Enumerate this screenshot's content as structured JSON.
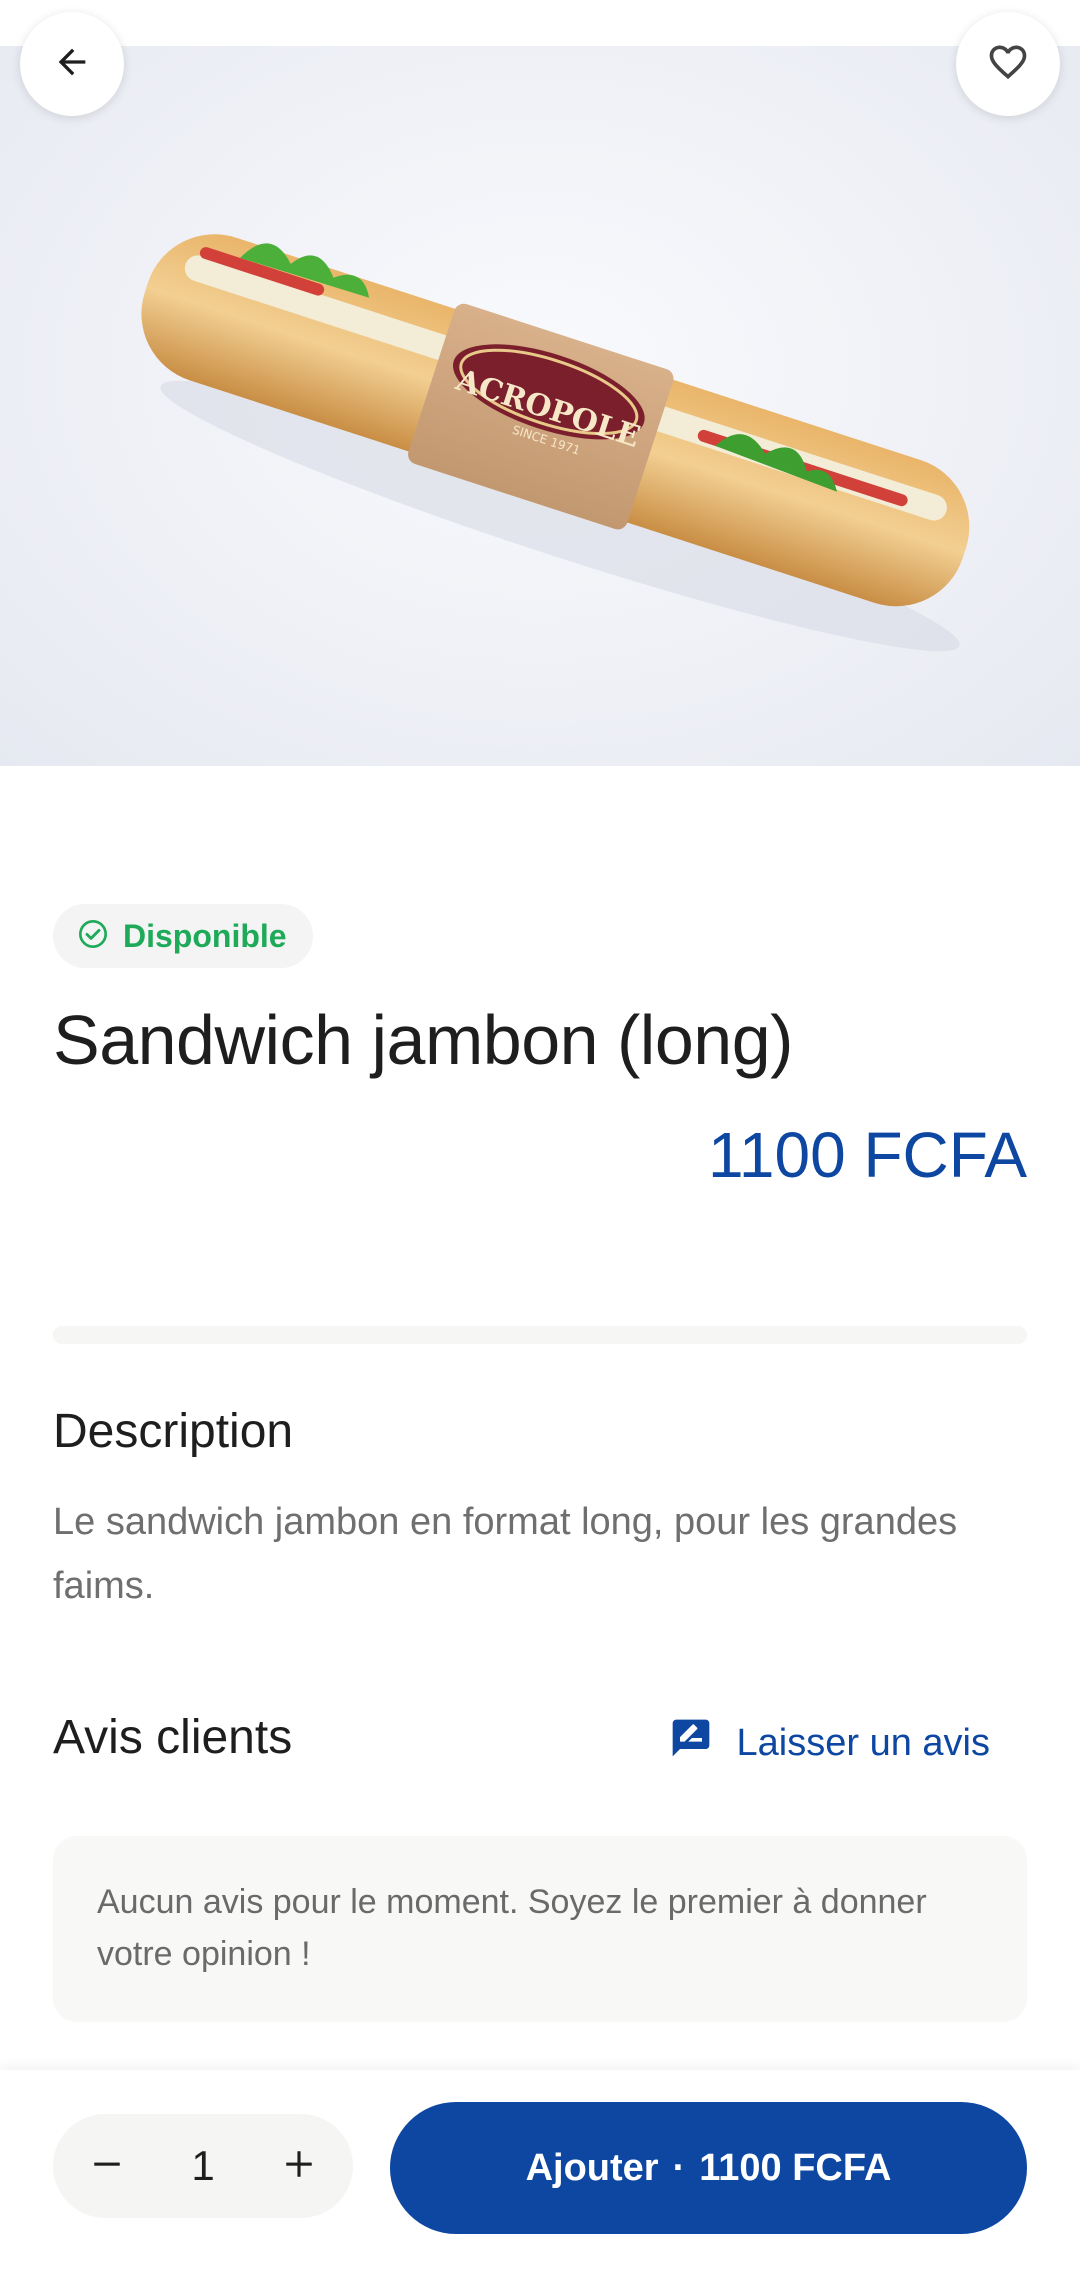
{
  "product": {
    "status": "Disponible",
    "name": "Sandwich jambon (long)",
    "price": "1100 FCFA",
    "image_label": "ACROPOLE",
    "image_label_sub": "SINCE 1971"
  },
  "description": {
    "title": "Description",
    "text": "Le sandwich jambon en format long, pour les grandes faims."
  },
  "reviews": {
    "title": "Avis clients",
    "leave_review_label": "Laisser un avis",
    "empty_text": "Aucun avis pour le moment. Soyez le premier à donner votre opinion !"
  },
  "cart": {
    "quantity": "1",
    "add_label": "Ajouter",
    "separator": "·",
    "add_price": "1100 FCFA"
  },
  "icons": {
    "back": "arrow-back-icon",
    "favorite": "heart-outline-icon",
    "status": "check-circle-icon",
    "review": "rate-review-icon",
    "minus": "minus-icon",
    "plus": "plus-icon"
  },
  "colors": {
    "accent": "#0d47a1",
    "available": "#1faa5a"
  }
}
